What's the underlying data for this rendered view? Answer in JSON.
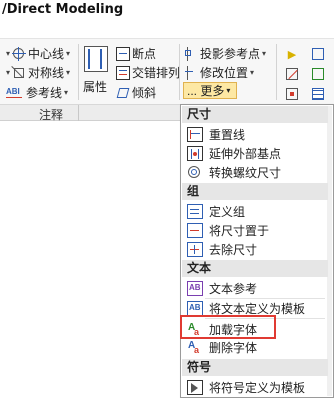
{
  "window": {
    "title": "/Direct Modeling"
  },
  "ribbon": {
    "centerline": "中心线",
    "symmetry": "对称线",
    "reference_line": "参考线",
    "properties": "属性",
    "break_point": "断点",
    "cross_arrange": "交错排列",
    "slant": "倾斜",
    "projection_ref": "投影参考点",
    "modify_position": "修改位置",
    "more": "... 更多",
    "group_label": "注释"
  },
  "menu": {
    "sections": [
      {
        "header": "尺寸",
        "items": [
          "重置线",
          "延伸外部基点",
          "转换螺纹尺寸"
        ]
      },
      {
        "header": "组",
        "items": [
          "定义组",
          "将尺寸置于",
          "去除尺寸"
        ]
      },
      {
        "header": "文本",
        "items": [
          "文本参考",
          "将文本定义为模板",
          "加载字体",
          "删除字体"
        ]
      },
      {
        "header": "符号",
        "items": [
          "将符号定义为模板"
        ]
      }
    ]
  },
  "highlight": {
    "item": "加载字体",
    "color": "#e03a32"
  },
  "colors": {
    "accent": "#2f5fb3",
    "more_button": "#fde8a4",
    "highlight_border": "#e03a32"
  }
}
